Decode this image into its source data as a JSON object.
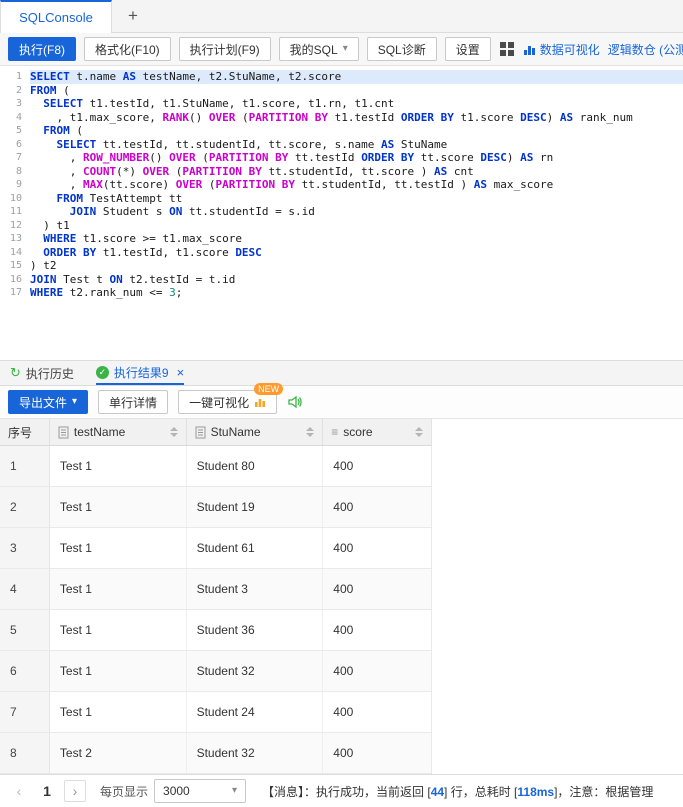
{
  "colors": {
    "accent": "#1765d8",
    "success": "#3bb346",
    "badge": "#ff9a2e",
    "keyword": "#0033cc",
    "function": "#cc00cc",
    "number": "#0c8a70",
    "active_line_bg": "#ddeafc"
  },
  "tabbar": {
    "tabs": [
      {
        "label": "SQLConsole",
        "active": true
      }
    ],
    "add_label": "+"
  },
  "toolbar": {
    "execute": "执行(F8)",
    "format": "格式化(F10)",
    "explain": "执行计划(F9)",
    "my_sql": "我的SQL",
    "diagnose": "SQL诊断",
    "settings": "设置",
    "visualize": "数据可视化",
    "logical_dw": "逻辑数仓 (公测)",
    "help": "?"
  },
  "editor": {
    "active_line": 1,
    "lines": [
      [
        [
          "k",
          "SELECT"
        ],
        [
          "p",
          " t.name "
        ],
        [
          "k",
          "AS"
        ],
        [
          "p",
          " testName, t2.StuName, t2.score"
        ]
      ],
      [
        [
          "k",
          "FROM"
        ],
        [
          "p",
          " ("
        ]
      ],
      [
        [
          "p",
          "  "
        ],
        [
          "k",
          "SELECT"
        ],
        [
          "p",
          " t1.testId, t1.StuName, t1.score, t1.rn, t1.cnt"
        ]
      ],
      [
        [
          "p",
          "    , t1.max_score, "
        ],
        [
          "f",
          "RANK"
        ],
        [
          "p",
          "() "
        ],
        [
          "f",
          "OVER"
        ],
        [
          "p",
          " ("
        ],
        [
          "f",
          "PARTITION BY"
        ],
        [
          "p",
          " t1.testId "
        ],
        [
          "k",
          "ORDER BY"
        ],
        [
          "p",
          " t1.score "
        ],
        [
          "k",
          "DESC"
        ],
        [
          "p",
          ") "
        ],
        [
          "k",
          "AS"
        ],
        [
          "p",
          " rank_num"
        ]
      ],
      [
        [
          "p",
          "  "
        ],
        [
          "k",
          "FROM"
        ],
        [
          "p",
          " ("
        ]
      ],
      [
        [
          "p",
          "    "
        ],
        [
          "k",
          "SELECT"
        ],
        [
          "p",
          " tt.testId, tt.studentId, tt.score, s.name "
        ],
        [
          "k",
          "AS"
        ],
        [
          "p",
          " StuName"
        ]
      ],
      [
        [
          "p",
          "      , "
        ],
        [
          "f",
          "ROW_NUMBER"
        ],
        [
          "p",
          "() "
        ],
        [
          "f",
          "OVER"
        ],
        [
          "p",
          " ("
        ],
        [
          "f",
          "PARTITION BY"
        ],
        [
          "p",
          " tt.testId "
        ],
        [
          "k",
          "ORDER BY"
        ],
        [
          "p",
          " tt.score "
        ],
        [
          "k",
          "DESC"
        ],
        [
          "p",
          ") "
        ],
        [
          "k",
          "AS"
        ],
        [
          "p",
          " rn"
        ]
      ],
      [
        [
          "p",
          "      , "
        ],
        [
          "f",
          "COUNT"
        ],
        [
          "p",
          "(*) "
        ],
        [
          "f",
          "OVER"
        ],
        [
          "p",
          " ("
        ],
        [
          "f",
          "PARTITION BY"
        ],
        [
          "p",
          " tt.studentId, tt.score ) "
        ],
        [
          "k",
          "AS"
        ],
        [
          "p",
          " cnt"
        ]
      ],
      [
        [
          "p",
          "      , "
        ],
        [
          "f",
          "MAX"
        ],
        [
          "p",
          "(tt.score) "
        ],
        [
          "f",
          "OVER"
        ],
        [
          "p",
          " ("
        ],
        [
          "f",
          "PARTITION BY"
        ],
        [
          "p",
          " tt.studentId, tt.testId ) "
        ],
        [
          "k",
          "AS"
        ],
        [
          "p",
          " max_score"
        ]
      ],
      [
        [
          "p",
          "    "
        ],
        [
          "k",
          "FROM"
        ],
        [
          "p",
          " TestAttempt tt"
        ]
      ],
      [
        [
          "p",
          "      "
        ],
        [
          "k",
          "JOIN"
        ],
        [
          "p",
          " Student s "
        ],
        [
          "k",
          "ON"
        ],
        [
          "p",
          " tt.studentId = s.id"
        ]
      ],
      [
        [
          "p",
          "  ) t1"
        ]
      ],
      [
        [
          "p",
          "  "
        ],
        [
          "k",
          "WHERE"
        ],
        [
          "p",
          " t1.score >= t1.max_score"
        ]
      ],
      [
        [
          "p",
          "  "
        ],
        [
          "k",
          "ORDER BY"
        ],
        [
          "p",
          " t1.testId, t1.score "
        ],
        [
          "k",
          "DESC"
        ]
      ],
      [
        [
          "p",
          ") t2"
        ]
      ],
      [
        [
          "k",
          "JOIN"
        ],
        [
          "p",
          " Test t "
        ],
        [
          "k",
          "ON"
        ],
        [
          "p",
          " t2.testId = t.id"
        ]
      ],
      [
        [
          "k",
          "WHERE"
        ],
        [
          "p",
          " t2.rank_num <= "
        ],
        [
          "n",
          "3"
        ],
        [
          "p",
          ";"
        ]
      ]
    ]
  },
  "result_panel": {
    "history_tab": "执行历史",
    "result_tab": "执行结果9",
    "close": "×"
  },
  "result_toolbar": {
    "export": "导出文件",
    "row_detail": "单行详情",
    "one_click_vis": "一键可视化",
    "new_badge": "NEW"
  },
  "table": {
    "headers": [
      "序号",
      "testName",
      "StuName",
      "score"
    ],
    "rows": [
      [
        "1",
        "Test 1",
        "Student 80",
        "400"
      ],
      [
        "2",
        "Test 1",
        "Student 19",
        "400"
      ],
      [
        "3",
        "Test 1",
        "Student 61",
        "400"
      ],
      [
        "4",
        "Test 1",
        "Student 3",
        "400"
      ],
      [
        "5",
        "Test 1",
        "Student 36",
        "400"
      ],
      [
        "6",
        "Test 1",
        "Student 32",
        "400"
      ],
      [
        "7",
        "Test 1",
        "Student 24",
        "400"
      ],
      [
        "8",
        "Test 2",
        "Student 32",
        "400"
      ]
    ]
  },
  "statusbar": {
    "page": "1",
    "page_size_label": "每页显示",
    "page_size": "3000",
    "message_parts": [
      {
        "text": "【消息】：执行成功，当前返回 [",
        "strong": false
      },
      {
        "text": "44",
        "strong": true
      },
      {
        "text": "] 行，总耗时 [",
        "strong": false
      },
      {
        "text": "118ms",
        "strong": true
      },
      {
        "text": "]，注意：根据管理",
        "strong": false
      }
    ]
  }
}
